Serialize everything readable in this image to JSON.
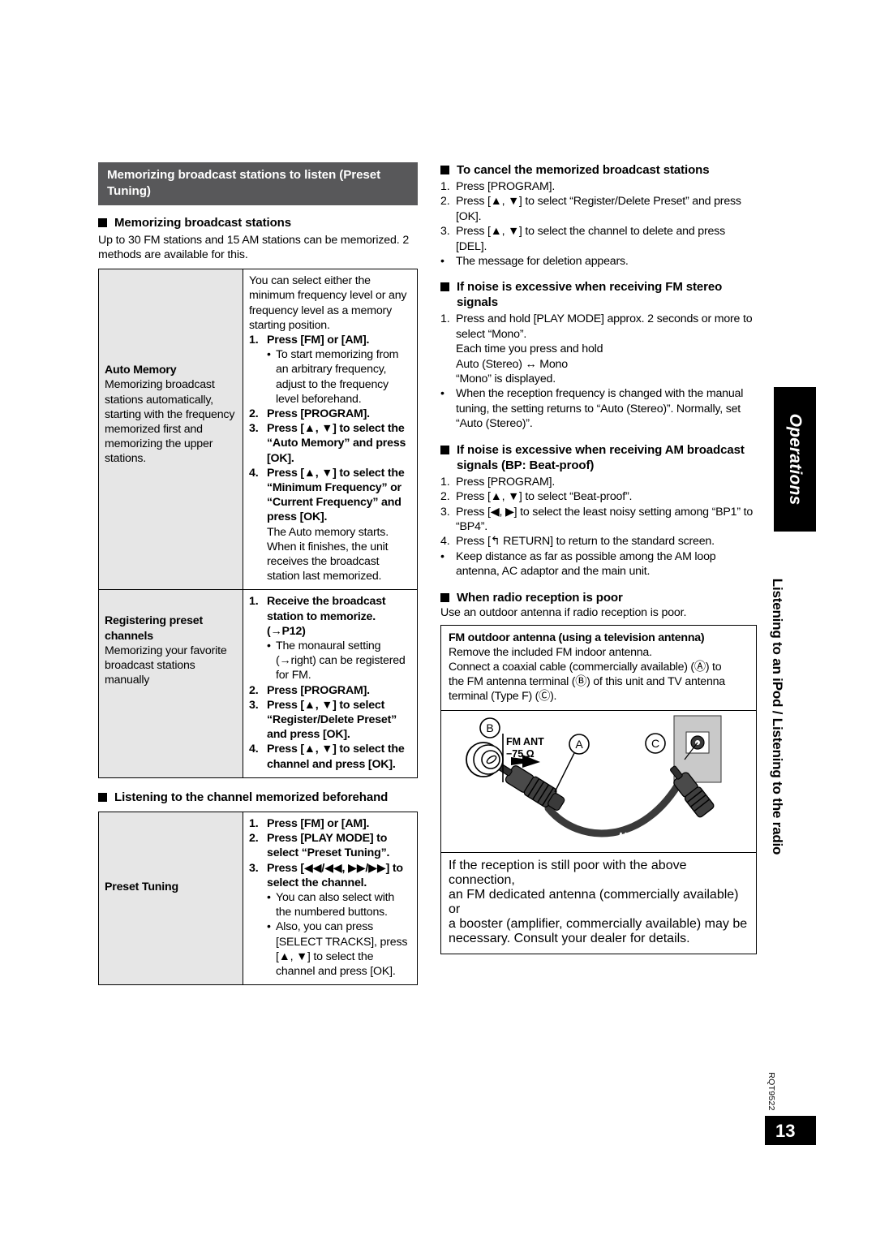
{
  "banner": {
    "title": "Memorizing broadcast stations to listen (Preset Tuning)"
  },
  "left": {
    "heading_memorizing": "Memorizing broadcast stations",
    "intro": "Up to 30 FM stations and 15 AM stations can be memorized. 2 methods are available for this.",
    "table1": {
      "rows": [
        {
          "label_title": "Auto Memory",
          "label_body": "Memorizing broadcast stations automatically, starting with the frequency memorized first and memorizing the upper stations.",
          "intro": "You can select either the minimum frequency level or any frequency level as a memory starting position.",
          "steps": [
            {
              "num": "1.",
              "text": "Press [FM] or [AM].",
              "bold": true,
              "bullets": [
                "To start memorizing from an arbitrary frequency, adjust to the frequency level beforehand."
              ]
            },
            {
              "num": "2.",
              "text": "Press [PROGRAM].",
              "bold": true,
              "bullets": []
            },
            {
              "num": "3.",
              "text": "Press [▲, ▼] to select the “Auto Memory” and press [OK].",
              "bold": true,
              "bullets": []
            },
            {
              "num": "4.",
              "text": "Press [▲, ▼] to select the “Minimum Frequency” or “Current Frequency” and press [OK].",
              "bold": true,
              "bullets": [],
              "after": "The Auto memory starts. When it finishes, the unit receives the broadcast station last memorized."
            }
          ]
        },
        {
          "label_title": "Registering preset channels",
          "label_body": "Memorizing your favorite broadcast stations manually",
          "intro": "",
          "steps": [
            {
              "num": "1.",
              "text": "Receive the broadcast station to memorize. (→P12)",
              "bold": true,
              "bullets": [
                "The monaural setting (→right) can be registered for FM."
              ]
            },
            {
              "num": "2.",
              "text": "Press [PROGRAM].",
              "bold": true,
              "bullets": []
            },
            {
              "num": "3.",
              "text": "Press [▲, ▼] to select “Register/Delete Preset” and press [OK].",
              "bold": true,
              "bullets": []
            },
            {
              "num": "4.",
              "text": "Press [▲, ▼] to select the channel and press [OK].",
              "bold": true,
              "bullets": []
            }
          ]
        }
      ]
    },
    "heading_listening": "Listening to the channel memorized beforehand",
    "table2": {
      "label_title": "Preset Tuning",
      "steps": [
        {
          "num": "1.",
          "text": "Press [FM] or [AM].",
          "bold": true,
          "bullets": []
        },
        {
          "num": "2.",
          "text": "Press [PLAY MODE] to select “Preset Tuning”.",
          "bold": true,
          "bullets": []
        },
        {
          "num": "3.",
          "text": "Press [◀◀/◀◀, ▶▶/▶▶] to select the channel.",
          "bold": true,
          "bullets": [
            "You can also select with the numbered buttons.",
            "Also, you can press [SELECT TRACKS], press [▲, ▼] to select the channel and press [OK]."
          ]
        }
      ]
    }
  },
  "right": {
    "s1": {
      "heading": "To cancel the memorized broadcast stations",
      "steps": [
        {
          "num": "1.",
          "text": "Press [PROGRAM]."
        },
        {
          "num": "2.",
          "text": "Press [▲, ▼] to select “Register/Delete Preset” and press [OK]."
        },
        {
          "num": "3.",
          "text": "Press [▲, ▼] to select the channel to delete and press [DEL]."
        }
      ],
      "bullets": [
        "The message for deletion appears."
      ]
    },
    "s2": {
      "heading_line1": "If noise is excessive when receiving FM stereo",
      "heading_line2": "signals",
      "steps": [
        {
          "num": "1.",
          "text": "Press and hold [PLAY MODE] approx. 2 seconds or more to select “Mono”."
        }
      ],
      "sublines": [
        "Each time you press and hold",
        "Auto (Stereo) ↔ Mono",
        "“Mono” is displayed."
      ],
      "bullets": [
        "When the reception frequency is changed with the manual tuning, the setting returns to “Auto (Stereo)”. Normally, set “Auto (Stereo)”."
      ]
    },
    "s3": {
      "heading_line1": "If noise is excessive when receiving AM",
      "heading_line2": "broadcast signals (BP: Beat-proof)",
      "steps": [
        {
          "num": "1.",
          "text": "Press [PROGRAM]."
        },
        {
          "num": "2.",
          "text": "Press [▲, ▼] to select “Beat-proof”."
        },
        {
          "num": "3.",
          "text": "Press [◀, ▶] to select the least noisy setting among “BP1” to “BP4”."
        },
        {
          "num": "4.",
          "text": "Press [↰ RETURN] to return to the standard screen."
        }
      ],
      "bullets": [
        "Keep distance as far as possible among the AM loop antenna, AC adaptor and the main unit."
      ]
    },
    "s4": {
      "heading": "When radio reception is poor",
      "para": "Use an outdoor antenna if radio reception is poor.",
      "box_title": "FM outdoor antenna (using a television antenna)",
      "box_lines": [
        "Remove the included FM indoor antenna.",
        "Connect a coaxial cable (commercially available) (Ⓐ) to",
        "the FM antenna terminal (Ⓑ) of this unit and TV antenna",
        "terminal (Type F) (Ⓒ)."
      ],
      "diagram": {
        "label_b": "B",
        "label_a": "A",
        "label_c": "C",
        "fm_ant": "FM ANT",
        "ohm": "−75 Ω"
      },
      "box2_lines": [
        "If the reception is still poor with the above connection,",
        "an FM dedicated antenna (commercially available) or",
        "a booster (amplifier, commercially available) may be",
        "necessary. Consult your dealer for details."
      ]
    }
  },
  "sidetab": {
    "chapter": "Operations",
    "section": "Listening to an iPod / Listening to the radio"
  },
  "footer": {
    "doc_code": "RQT9522",
    "page_number": "13"
  },
  "colors": {
    "banner_bg": "#58585a",
    "table_label_bg": "#e6e6e6",
    "tab_bg": "#000000"
  }
}
